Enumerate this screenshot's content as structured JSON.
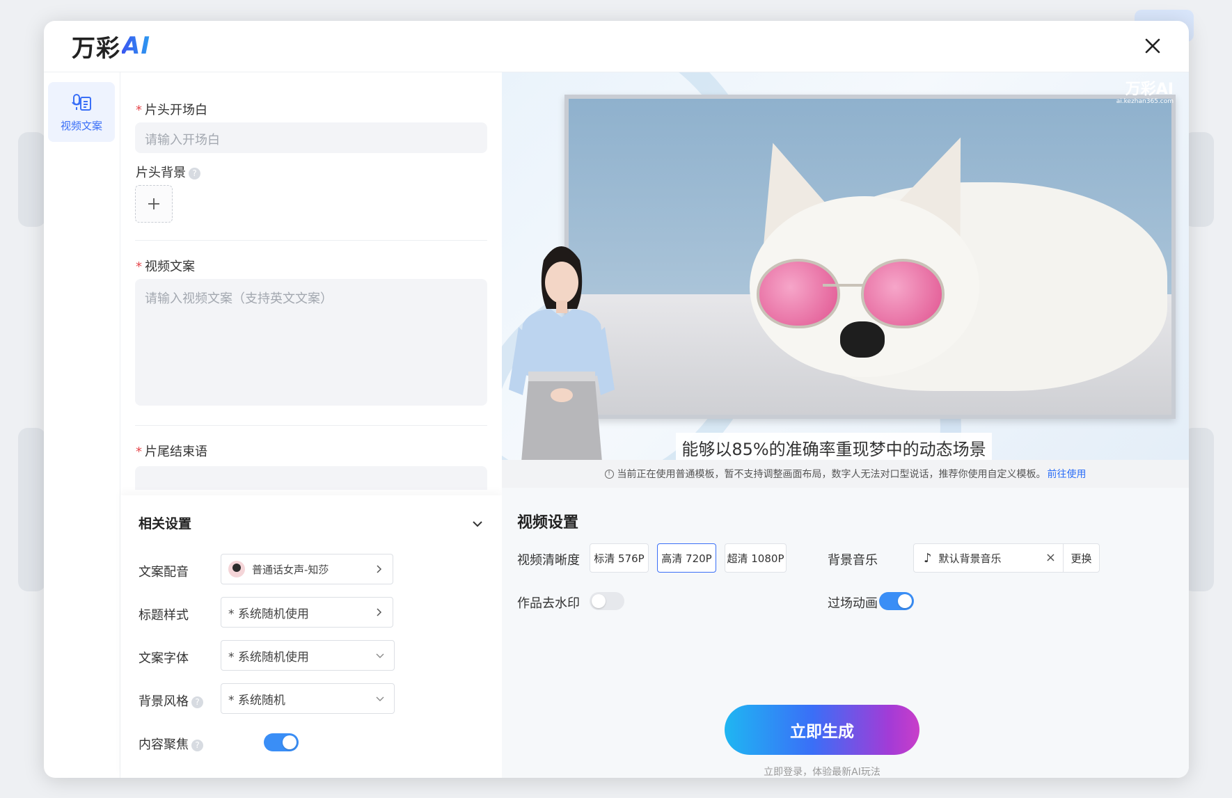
{
  "app": {
    "logo_text": "万彩",
    "logo_ai": "AI"
  },
  "sidebar": {
    "items": [
      {
        "label": "视频文案",
        "icon": "script-mic-icon",
        "active": true
      }
    ]
  },
  "form": {
    "opening": {
      "label": "片头开场白",
      "required": true,
      "placeholder": "请输入开场白"
    },
    "opening_bg": {
      "label": "片头背景",
      "help": "?"
    },
    "script": {
      "label": "视频文案",
      "required": true,
      "placeholder": "请输入视频文案（支持英文文案）"
    },
    "ending": {
      "label": "片尾结束语",
      "required": true
    }
  },
  "settings": {
    "title": "相关设置",
    "voice": {
      "label": "文案配音",
      "value": "普通话女声-知莎"
    },
    "title_style": {
      "label": "标题样式",
      "value": "* 系统随机使用"
    },
    "font": {
      "label": "文案字体",
      "value": "* 系统随机使用"
    },
    "bg_style": {
      "label": "背景风格",
      "value": "* 系统随机"
    },
    "focus": {
      "label": "内容聚焦",
      "enabled": true
    }
  },
  "preview": {
    "caption": "能够以85%的准确率重现梦中的动态场景",
    "watermark": "万彩AI",
    "watermark_url": "ai.kezhan365.com",
    "notice": "当前正在使用普通模板，暂不支持调整画面布局，数字人无法对口型说话，推荐你使用自定义模板。",
    "notice_link": "前往使用"
  },
  "video_settings": {
    "title": "视频设置",
    "quality_label": "视频清晰度",
    "quality_options": [
      "标清 576P",
      "高清 720P",
      "超清 1080P"
    ],
    "quality_selected": "高清 720P",
    "music_label": "背景音乐",
    "music_value": "默认背景音乐",
    "music_change": "更换",
    "watermark_label": "作品去水印",
    "watermark_enabled": false,
    "transition_label": "过场动画",
    "transition_enabled": true,
    "generate_label": "立即生成",
    "generate_sub": "立即登录，体验最新AI玩法"
  },
  "colors": {
    "accent": "#3a6ff7",
    "toggle_on": "#3a8ef6",
    "required": "#e5484d"
  }
}
